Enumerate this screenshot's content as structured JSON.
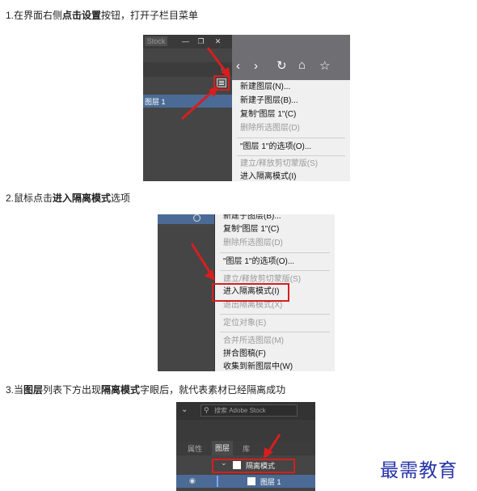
{
  "steps": {
    "s1": {
      "pre": "1.在界面右侧",
      "bold": "点击设置",
      "post": "按钮，打开子栏目菜单"
    },
    "s2": {
      "pre": "2.鼠标点击",
      "bold": "进入隔离模式",
      "post": "选项"
    },
    "s3": {
      "pre": "3.当",
      "bold1": "图层",
      "mid": "列表下方出现",
      "bold2": "隔离模式",
      "post": "字眼后，就代表素材已经隔离成功"
    }
  },
  "shot1": {
    "tab_label": "Stock",
    "win_buttons": [
      "—",
      "❐",
      "✕"
    ],
    "layer_name": "图层 1",
    "menu_items": [
      {
        "label": "新建图层(N)...",
        "disabled": false
      },
      {
        "label": "新建子图层(B)...",
        "disabled": false
      },
      {
        "label": "复制\"图层 1\"(C)",
        "disabled": false
      },
      {
        "label": "删除所选图层(D)",
        "disabled": true
      },
      {
        "label": "\"图层 1\"的选项(O)...",
        "disabled": false
      },
      {
        "label": "建立/释放剪切蒙版(S)",
        "disabled": true
      },
      {
        "label": "进入隔离模式(I)",
        "disabled": false
      }
    ]
  },
  "shot2": {
    "menu_items": [
      {
        "label": "新建子图层(B)...",
        "disabled": false
      },
      {
        "label": "复制\"图层 1\"(C)",
        "disabled": false
      },
      {
        "label": "删除所选图层(D)",
        "disabled": true
      },
      {
        "label": "\"图层 1\"的选项(O)...",
        "disabled": false
      },
      {
        "label": "建立/释放剪切蒙版(S)",
        "disabled": true
      },
      {
        "label": "进入隔离模式(I)",
        "disabled": false
      },
      {
        "label": "退出隔离模式(X)",
        "disabled": true
      },
      {
        "label": "定位对象(E)",
        "disabled": true
      },
      {
        "label": "合并所选图层(M)",
        "disabled": true
      },
      {
        "label": "拼合图稿(F)",
        "disabled": false
      },
      {
        "label": "收集到新图层中(W)",
        "disabled": false
      }
    ]
  },
  "shot3": {
    "search_placeholder": "搜索 Adobe Stock",
    "tabs": [
      "属性",
      "图层",
      "库"
    ],
    "isolation_label": "隔离模式",
    "layer_name": "图层 1"
  },
  "watermark": "最需教育",
  "colors": {
    "accent_red": "#d81e1e",
    "menu_bg": "#f0f0f0",
    "panel_dark": "#454545",
    "selected_row": "#4b6b96"
  }
}
